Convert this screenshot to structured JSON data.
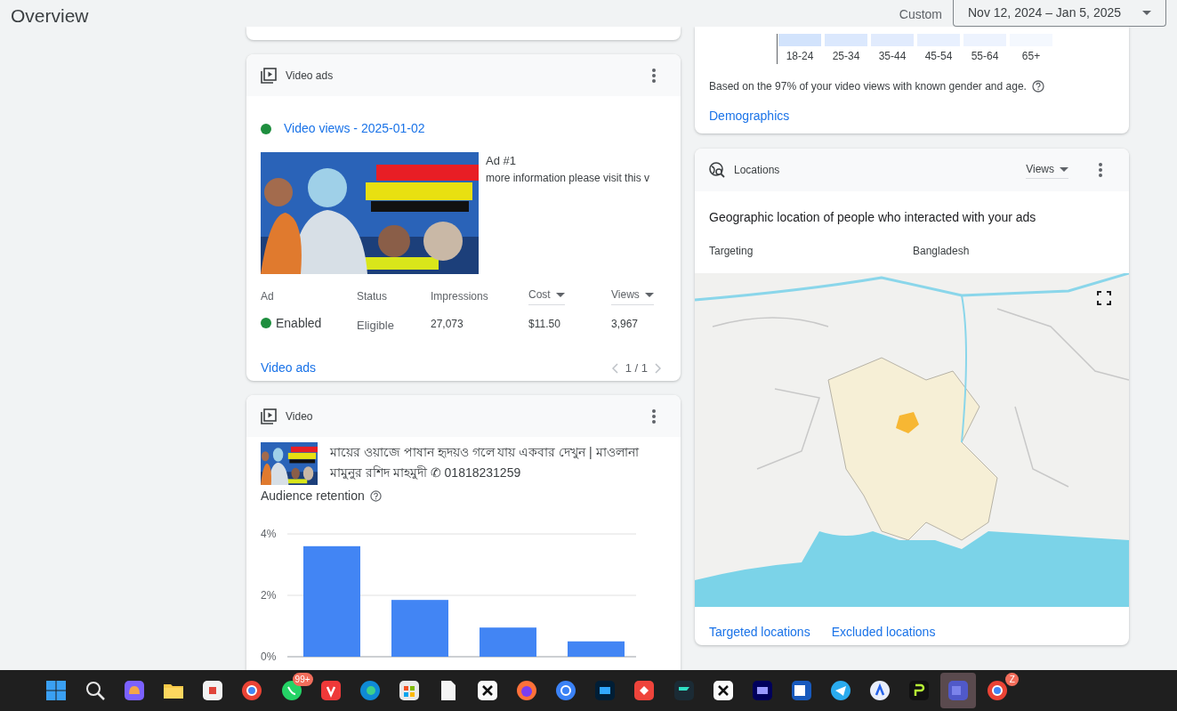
{
  "header": {
    "title": "Overview",
    "range_label": "Custom",
    "date_range": "Nov 12, 2024 – Jan 5, 2025"
  },
  "demographics": {
    "age_groups": [
      "18-24",
      "25-34",
      "35-44",
      "45-54",
      "55-64",
      "65+"
    ],
    "note": "Based on the 97% of your video views with known gender and age.",
    "link": "Demographics"
  },
  "video_ads": {
    "title": "Video ads",
    "campaign": {
      "name": "Video views - 2025-01-02",
      "enabled": true
    },
    "ad": {
      "name": "Ad #1",
      "description": "more information please visit this v"
    },
    "columns": [
      {
        "label": "Ad",
        "sortable": false
      },
      {
        "label": "Status",
        "sortable": false
      },
      {
        "label": "Impressions",
        "sortable": false
      },
      {
        "label": "Cost",
        "sortable": true
      },
      {
        "label": "Views",
        "sortable": true
      }
    ],
    "row": {
      "ad": "Enabled",
      "enabled": true,
      "status": "Eligible",
      "impressions": "27,073",
      "cost": "$11.50",
      "views": "3,967"
    },
    "link": "Video ads",
    "pager": "1 / 1"
  },
  "video": {
    "title": "Video",
    "video_title": "মায়ের ওয়াজে পাষান হৃদয়ও গলে যায় একবার দেখুন | মাওলানা মামুনুর রশিদ মাহমুদী ✆ 01818231259",
    "section": "Audience retention",
    "chart_data": {
      "type": "bar",
      "values": [
        3.6,
        1.85,
        0.95,
        0.5
      ],
      "ylim": [
        0,
        4
      ],
      "yticks": [
        {
          "value": 0,
          "label": "0%"
        },
        {
          "value": 2,
          "label": "2%"
        },
        {
          "value": 4,
          "label": "4%"
        }
      ]
    }
  },
  "locations": {
    "title": "Locations",
    "metric": "Views",
    "heading": "Geographic location of people who interacted with your ads",
    "targeting_label": "Targeting",
    "targeting_value": "Bangladesh",
    "links": [
      "Targeted locations",
      "Excluded locations"
    ]
  },
  "taskbar": {
    "apps": [
      {
        "selected": false
      },
      {
        "selected": false
      },
      {
        "selected": false
      },
      {
        "selected": false
      },
      {
        "selected": false
      },
      {
        "selected": false
      },
      {
        "selected": false,
        "badge": "99+"
      },
      {
        "selected": false
      },
      {
        "selected": false
      },
      {
        "selected": false
      },
      {
        "selected": false
      },
      {
        "selected": false
      },
      {
        "selected": false
      },
      {
        "selected": false
      },
      {
        "selected": false
      },
      {
        "selected": false
      },
      {
        "selected": false
      },
      {
        "selected": false
      },
      {
        "selected": false
      },
      {
        "selected": false
      },
      {
        "selected": false
      },
      {
        "selected": false
      },
      {
        "selected": false
      },
      {
        "selected": true
      },
      {
        "selected": false,
        "badge": "Z"
      }
    ]
  }
}
